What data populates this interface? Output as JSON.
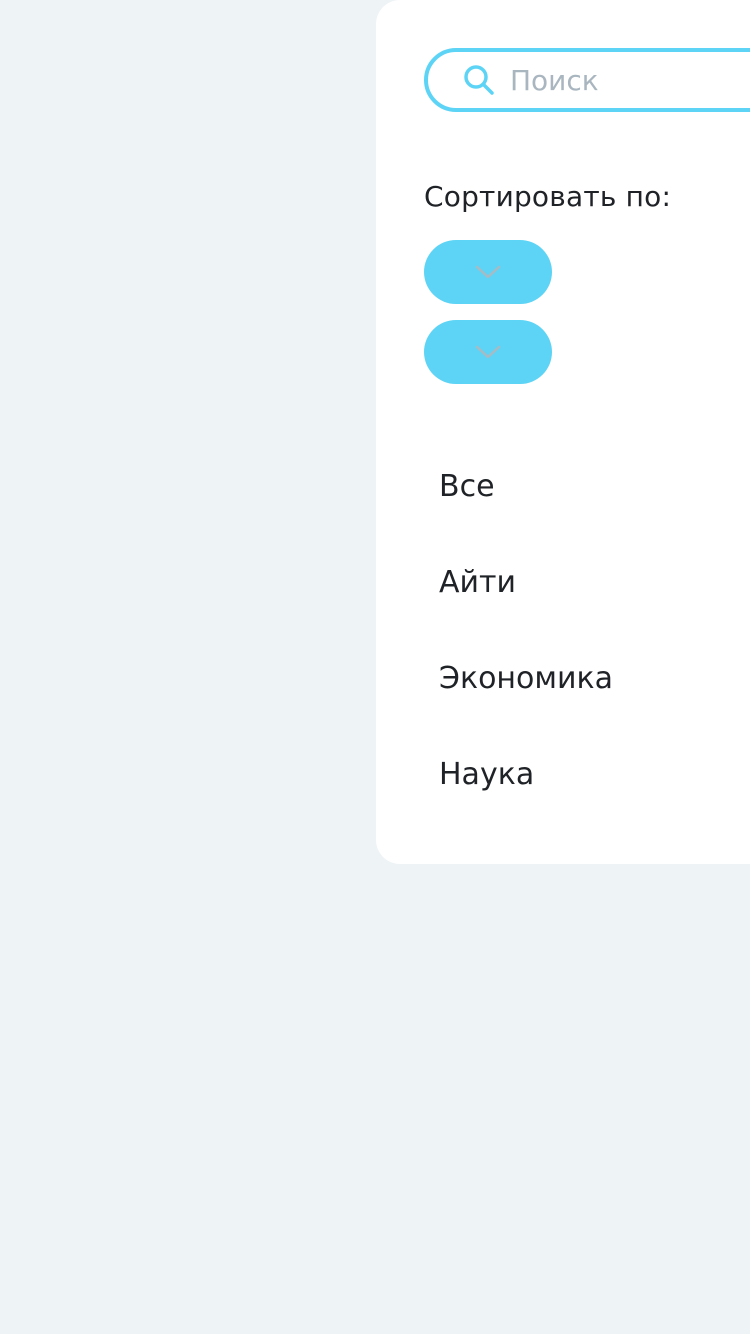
{
  "search": {
    "placeholder": "Поиск",
    "icon": "search-icon"
  },
  "sort": {
    "label": "Сортировать по:",
    "dropdowns": [
      {
        "icon": "chevron-down-icon"
      },
      {
        "icon": "chevron-down-icon"
      }
    ]
  },
  "categories": [
    {
      "label": "Все"
    },
    {
      "label": "Айти"
    },
    {
      "label": "Экономика"
    },
    {
      "label": "Наука"
    }
  ],
  "colors": {
    "accent": "#5DD4F5",
    "background": "#EEF3F6",
    "panel": "#FFFFFF",
    "text": "#1F2226",
    "placeholder": "#A9B6BF",
    "chevron": "#A7BBC4"
  }
}
